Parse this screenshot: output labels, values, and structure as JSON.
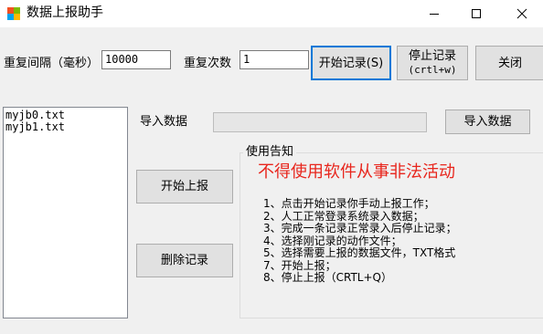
{
  "window": {
    "title": "数据上报助手",
    "icons": {
      "app": "app-icon",
      "minimize": "minimize-icon",
      "maximize": "maximize-icon",
      "close": "close-icon"
    }
  },
  "controls": {
    "repeat_interval_label": "重复间隔（毫秒）",
    "repeat_interval_value": "10000",
    "repeat_count_label": "重复次数",
    "repeat_count_value": "1",
    "start_record_label": "开始记录(S)",
    "stop_record_label": "停止记录",
    "stop_record_shortcut": "(crtl+w)",
    "close_label": "关闭"
  },
  "file_list": {
    "items": [
      "myjb0.txt",
      "myjb1.txt"
    ]
  },
  "import": {
    "label": "导入数据",
    "button_label": "导入数据",
    "progress": 0
  },
  "actions": {
    "start_report_label": "开始上报",
    "delete_record_label": "删除记录"
  },
  "notice": {
    "title": "使用告知",
    "warning": "不得使用软件从事非法活动",
    "steps": [
      "1、点击开始记录你手动上报工作；",
      "2、人工正常登录系统录入数据；",
      "3、完成一条记录正常录入后停止记录；",
      "4、选择刚记录的动作文件；",
      "5、选择需要上报的数据文件，TXT格式",
      "7、开始上报；",
      "8、停止上报（CRTL+Q）"
    ]
  },
  "colors": {
    "warning": "#e8261d",
    "focus_border": "#0078d7"
  }
}
